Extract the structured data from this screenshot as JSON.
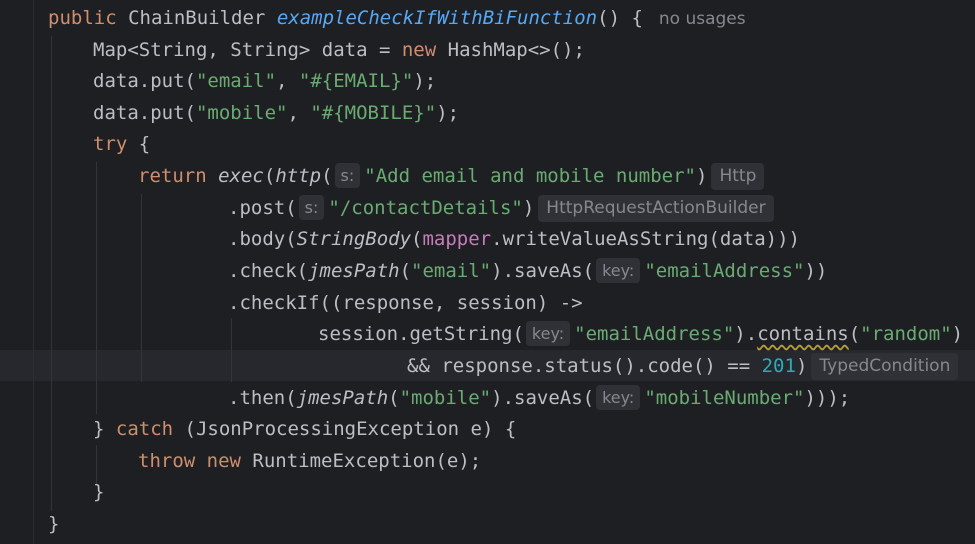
{
  "editor": {
    "usages_hint": "no usages",
    "colors": {
      "background": "#1e1f22",
      "keyword": "#cf8e6d",
      "string": "#6aab73",
      "number": "#2aacb8",
      "method_decl": "#56a8f5",
      "field": "#c77dbb"
    },
    "lines": {
      "l1": {
        "kw": "public",
        "type": "ChainBuilder",
        "method": "exampleCheckIfWithBiFunction",
        "rest": "() {"
      },
      "l2": {
        "pre": "Map<String, String> data = ",
        "kw": "new",
        "post": " HashMap<>();"
      },
      "l3": {
        "pre": "data.put(",
        "s1": "\"email\"",
        "mid": ", ",
        "s2": "\"#{EMAIL}\"",
        "post": ");"
      },
      "l4": {
        "pre": "data.put(",
        "s1": "\"mobile\"",
        "mid": ", ",
        "s2": "\"#{MOBILE}\"",
        "post": ");"
      },
      "l5": {
        "kw": "try",
        "post": " {"
      },
      "l6": {
        "kw": "return",
        "fn1": "exec",
        "p1": "(",
        "fn2": "http",
        "p2": "(",
        "hint": "s:",
        "str": "\"Add email and mobile number\"",
        "post": ")",
        "type_hint": "Http"
      },
      "l7": {
        "pre": ".post(",
        "hint": "s:",
        "str": "\"/contactDetails\"",
        "post": ")",
        "type_hint": "HttpRequestActionBuilder"
      },
      "l8": {
        "pre": ".body(",
        "fn": "StringBody",
        "p1": "(",
        "field": "mapper",
        "post": ".writeValueAsString(data)))"
      },
      "l9": {
        "pre": ".check(",
        "fn": "jmesPath",
        "p1": "(",
        "s1": "\"email\"",
        "mid": ").saveAs(",
        "hint": "key:",
        "s2": "\"emailAddress\"",
        "post": "))"
      },
      "l10": {
        "text": ".checkIf((response, session) ->"
      },
      "l11": {
        "pre": "session.getString(",
        "hint": "key:",
        "s1": "\"emailAddress\"",
        "mid": ").",
        "warn": "contains",
        "p": "(",
        "s2": "\"random\"",
        "post": ")"
      },
      "l12": {
        "pre": "&& response.status().code() == ",
        "num": "201",
        "post": ")",
        "type_hint": "TypedCondition"
      },
      "l13": {
        "pre": ".then(",
        "fn": "jmesPath",
        "p1": "(",
        "s1": "\"mobile\"",
        "mid": ").saveAs(",
        "hint": "key:",
        "s2": "\"mobileNumber\"",
        "post": ")));"
      },
      "l14": {
        "pre": "} ",
        "kw": "catch",
        "post": " (JsonProcessingException e) {"
      },
      "l15": {
        "kw1": "throw",
        "sp": " ",
        "kw2": "new",
        "post": " RuntimeException(e);"
      },
      "l16": {
        "text": "}"
      },
      "l17": {
        "text": "}"
      }
    }
  }
}
